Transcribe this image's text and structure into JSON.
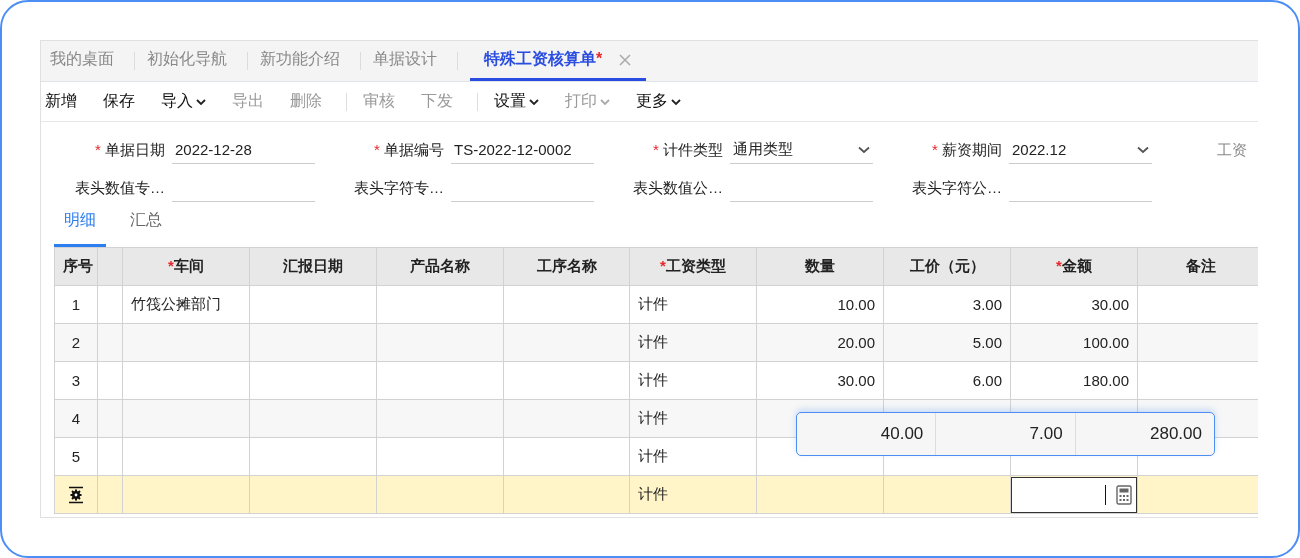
{
  "tabs": [
    {
      "label": "我的桌面",
      "selected": false,
      "closable": false
    },
    {
      "label": "初始化导航",
      "selected": false,
      "closable": false
    },
    {
      "label": "新功能介绍",
      "selected": false,
      "closable": false
    },
    {
      "label": "单据设计",
      "selected": false,
      "closable": false
    },
    {
      "label": "特殊工资核算单",
      "marker": "*",
      "selected": true,
      "closable": true
    }
  ],
  "toolbar": [
    {
      "kind": "button",
      "label": "新增",
      "disabled": false,
      "dropdown": false
    },
    {
      "kind": "button",
      "label": "保存",
      "disabled": false,
      "dropdown": false
    },
    {
      "kind": "button",
      "label": "导入",
      "disabled": false,
      "dropdown": true
    },
    {
      "kind": "button",
      "label": "导出",
      "disabled": true,
      "dropdown": false
    },
    {
      "kind": "button",
      "label": "删除",
      "disabled": true,
      "dropdown": false
    },
    {
      "kind": "separator"
    },
    {
      "kind": "button",
      "label": "审核",
      "disabled": true,
      "dropdown": false
    },
    {
      "kind": "button",
      "label": "下发",
      "disabled": true,
      "dropdown": false
    },
    {
      "kind": "separator"
    },
    {
      "kind": "button",
      "label": "设置",
      "disabled": false,
      "dropdown": true
    },
    {
      "kind": "button",
      "label": "打印",
      "disabled": true,
      "dropdown": true
    },
    {
      "kind": "button",
      "label": "更多",
      "disabled": false,
      "dropdown": true
    }
  ],
  "form": {
    "rows": [
      [
        {
          "label": "单据日期",
          "required": true,
          "value": "2022-12-28",
          "dropdown": false
        },
        {
          "label": "单据编号",
          "required": true,
          "value": "TS-2022-12-0002",
          "dropdown": false
        },
        {
          "label": "计件类型",
          "required": true,
          "value": "通用类型",
          "dropdown": true
        },
        {
          "label": "薪资期间",
          "required": true,
          "value": "2022.12",
          "dropdown": true
        },
        {
          "label": "工资",
          "required": false,
          "cut": true
        }
      ],
      [
        {
          "label": "表头数值专…",
          "required": false,
          "dropdown": false
        },
        {
          "label": "表头字符专…",
          "required": false,
          "dropdown": false
        },
        {
          "label": "表头数值公…",
          "required": false,
          "dropdown": false
        },
        {
          "label": "表头字符公…",
          "required": false,
          "dropdown": false
        }
      ]
    ]
  },
  "detail_tabs": [
    {
      "label": "明细",
      "selected": true
    },
    {
      "label": "汇总",
      "selected": false
    }
  ],
  "table": {
    "columns": [
      {
        "label": "序号",
        "required": false
      },
      {
        "required": false
      },
      {
        "label": "车间",
        "required": true
      },
      {
        "label": "汇报日期",
        "required": false
      },
      {
        "label": "产品名称",
        "required": false
      },
      {
        "label": "工序名称",
        "required": false
      },
      {
        "label": "工资类型",
        "required": true
      },
      {
        "label": "数量",
        "required": false
      },
      {
        "label": "工价（元）",
        "required": false
      },
      {
        "label": "金额",
        "required": true
      },
      {
        "label": "备注",
        "required": false
      }
    ],
    "rows": [
      {
        "kind": "data",
        "index": "1",
        "workshop": "竹筏公摊部门",
        "wage_type": "计件",
        "quantity": "10.00",
        "unit_price": "3.00",
        "amount": "30.00"
      },
      {
        "kind": "data",
        "index": "2",
        "wage_type": "计件",
        "quantity": "20.00",
        "unit_price": "5.00",
        "amount": "100.00"
      },
      {
        "kind": "data",
        "index": "3",
        "wage_type": "计件",
        "quantity": "30.00",
        "unit_price": "6.00",
        "amount": "180.00"
      },
      {
        "kind": "data",
        "index": "4",
        "wage_type": "计件"
      },
      {
        "kind": "data",
        "index": "5",
        "wage_type": "计件"
      },
      {
        "kind": "new",
        "wage_type": "计件",
        "amount_editing": true
      }
    ],
    "magnifier": {
      "values": [
        "40.00",
        "7.00",
        "280.00"
      ]
    }
  }
}
